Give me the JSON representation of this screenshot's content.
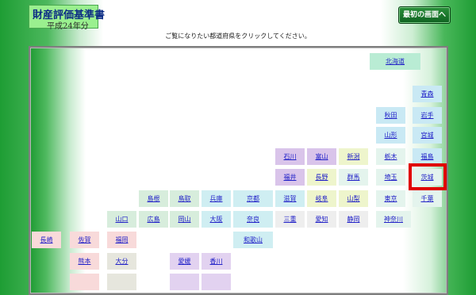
{
  "header": {
    "title": "財産評価基準書",
    "subtitle": "平成24年分",
    "home_button": "最初の画面へ"
  },
  "instruction": "ご覧になりたい都道府県をクリックしてください。",
  "prefectures": {
    "hokkaido": "北海道",
    "aomori": "青森",
    "akita": "秋田",
    "iwate": "岩手",
    "yamagata": "山形",
    "miyagi": "宮城",
    "ishikawa": "石川",
    "toyama": "富山",
    "niigata": "新潟",
    "tochigi": "栃木",
    "fukushima": "福島",
    "fukui": "福井",
    "nagano": "長野",
    "gunma": "群馬",
    "saitama": "埼玉",
    "ibaraki": "茨城",
    "shimane": "島根",
    "tottori": "鳥取",
    "hyogo": "兵庫",
    "kyoto": "京都",
    "shiga": "滋賀",
    "gifu": "岐阜",
    "yamanashi": "山梨",
    "tokyo": "東京",
    "chiba": "千葉",
    "yamaguchi": "山口",
    "hiroshima": "広島",
    "okayama": "岡山",
    "osaka": "大阪",
    "nara": "奈良",
    "mie": "三重",
    "aichi": "愛知",
    "shizuoka": "静岡",
    "kanagawa": "神奈川",
    "nagasaki": "長崎",
    "saga": "佐賀",
    "fukuoka": "福岡",
    "wakayama": "和歌山",
    "kumamoto": "熊本",
    "oita": "大分",
    "ehime": "愛媛",
    "kagawa": "香川"
  }
}
